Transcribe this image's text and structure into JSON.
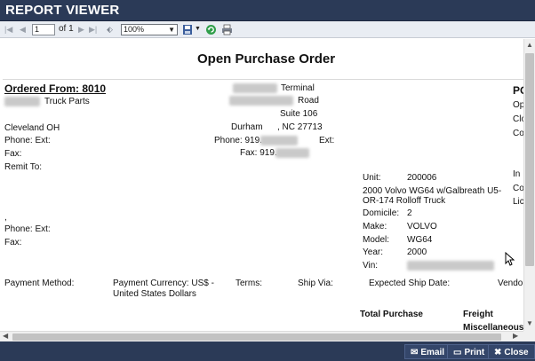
{
  "window": {
    "title": "REPORT VIEWER"
  },
  "toolbar": {
    "page_value": "1",
    "page_of": "of 1",
    "zoom": "100%",
    "icons": [
      "first-page-icon",
      "prev-page-icon",
      "next-page-icon",
      "last-page-icon",
      "back-icon",
      "save-icon",
      "refresh-icon",
      "print-icon"
    ]
  },
  "report": {
    "title": "Open Purchase Order",
    "ordered_from": "Ordered From: 8010",
    "vendor_name_suffix": "Truck Parts",
    "vendor_city": "Cleveland  OH",
    "vendor_phone": "Phone:  Ext:",
    "vendor_fax": "Fax:",
    "remit_to": "Remit To:",
    "remit_comma": ",",
    "remit_phone": "Phone:  Ext:",
    "remit_fax": "Fax:",
    "terminal_suffix": "Terminal",
    "road_suffix": "Road",
    "suite": "Suite 106",
    "ship_city": "Durham",
    "ship_state_zip": ",  NC  27713",
    "ship_phone_label": "Phone: 919.",
    "ship_ext": "Ext:",
    "ship_fax_label": "Fax: 919.",
    "po_cut": "PO",
    "right_cut": [
      "Op",
      "Clo",
      "Co",
      "In :",
      "Co",
      "Lic"
    ],
    "unit_label": "Unit:",
    "unit_value": "200006",
    "unit_desc_1": "2000 Volvo WG64 w/Galbreath U5-",
    "unit_desc_2": "OR-174 Rolloff Truck",
    "domicile_label": "Domicile:",
    "domicile_value": "2",
    "make_label": "Make:",
    "make_value": "VOLVO",
    "model_label": "Model:",
    "model_value": "WG64",
    "year_label": "Year:",
    "year_value": "2000",
    "vin_label": "Vin:",
    "payment_method": "Payment Method:",
    "payment_currency_1": "Payment Currency: US$ -",
    "payment_currency_2": "United States Dollars",
    "terms": "Terms:",
    "ship_via": "Ship Via:",
    "expected_ship_date": "Expected Ship Date:",
    "vendor_cut": "Vendor",
    "total_purchase": "Total Purchase",
    "freight": "Freight",
    "miscellaneous": "Miscellaneous"
  },
  "footer": {
    "email": "Email",
    "print": "Print",
    "close": "Close"
  }
}
